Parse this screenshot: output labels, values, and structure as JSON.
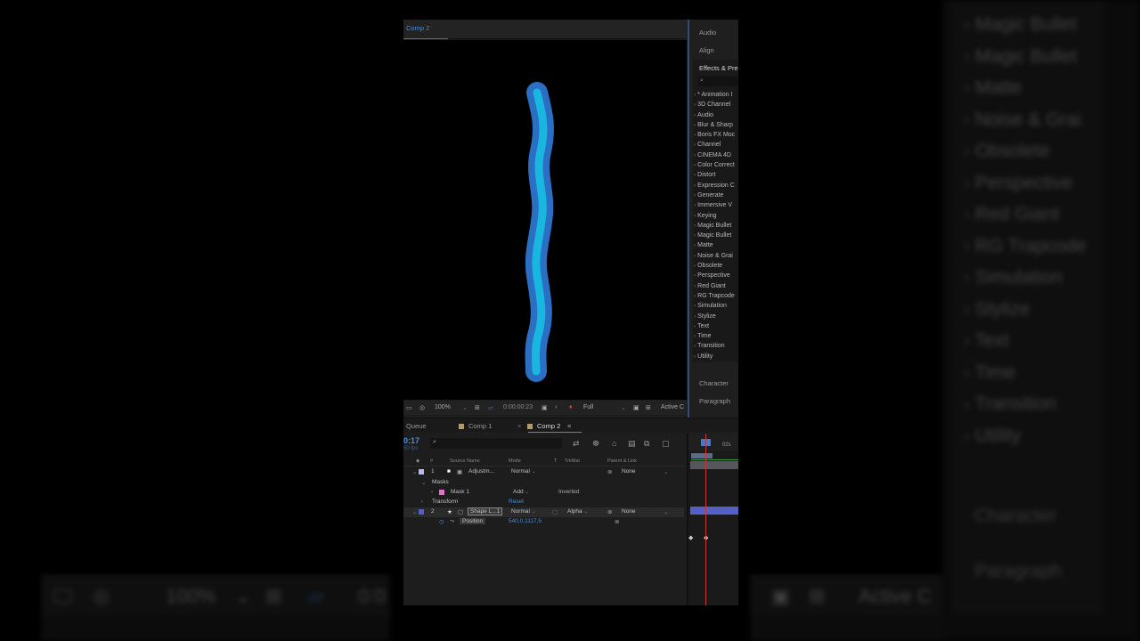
{
  "backdrop": {
    "right_list": [
      "Magic Bullet",
      "Magic Bullet",
      "Matte",
      "Noise & Grai",
      "Obsolete",
      "Perspective",
      "Red Giant",
      "RG Trapcode",
      "Simulation",
      "Stylize",
      "Text",
      "Time",
      "Transition",
      "Utility"
    ],
    "character": "Character",
    "paragraph": "Paragraph",
    "zoom": "100%",
    "timecode_fragment": "0:0",
    "active_camera_fragment": "Active C"
  },
  "composition": {
    "tab_label": "Comp 2"
  },
  "viewer_toolbar": {
    "zoom": "100%",
    "timecode": "0:00:00:23",
    "resolution": "Full",
    "camera": "Active C"
  },
  "right_panel": {
    "tabs": {
      "audio": "Audio",
      "align": "Align",
      "character": "Character",
      "paragraph": "Paragraph"
    },
    "effects_title": "Effects & Pres",
    "search_placeholder": "",
    "effects": [
      "* Animation I",
      "3D Channel",
      "Audio",
      "Blur & Sharp",
      "Boris FX Moc",
      "Channel",
      "CINEMA 4D",
      "Color Correct",
      "Distort",
      "Expression C",
      "Generate",
      "Immersive V",
      "Keying",
      "Magic Bullet",
      "Magic Bullet",
      "Matte",
      "Noise & Grai",
      "Obsolete",
      "Perspective",
      "Red Giant",
      "RG Trapcode",
      "Simulation",
      "Stylize",
      "Text",
      "Time",
      "Transition",
      "Utility"
    ]
  },
  "timeline": {
    "tabs": {
      "queue": "Queue",
      "comp1": "Comp 1",
      "comp2": "Comp 2"
    },
    "timecode": "0:17",
    "fps": "50 fps",
    "ruler_label": "02s",
    "columns": {
      "hash": "#",
      "source_name": "Source Name",
      "mode": "Mode",
      "t": "T",
      "trkmat": "TrkMat",
      "parent": "Parent & Link"
    },
    "layer1": {
      "index": "1",
      "name": "Adjustm...",
      "mode": "Normal",
      "parent": "None",
      "color": "#b7b9e6"
    },
    "masks_label": "Masks",
    "mask1": {
      "name": "Mask 1",
      "mode": "Add",
      "inverted": "Inverted",
      "color": "#e070c8"
    },
    "transform": {
      "label": "Transform",
      "reset": "Reset"
    },
    "layer2": {
      "index": "2",
      "name": "Shape L...1",
      "mode": "Normal",
      "trkmat": "Alpha",
      "parent": "None",
      "color": "#5560c6"
    },
    "position": {
      "label": "Position",
      "value": "540,0,1117,5"
    }
  },
  "colors": {
    "accent": "#4a8bd8",
    "shape_outer": "#2a6fc4",
    "shape_inner": "#19b6e0"
  }
}
